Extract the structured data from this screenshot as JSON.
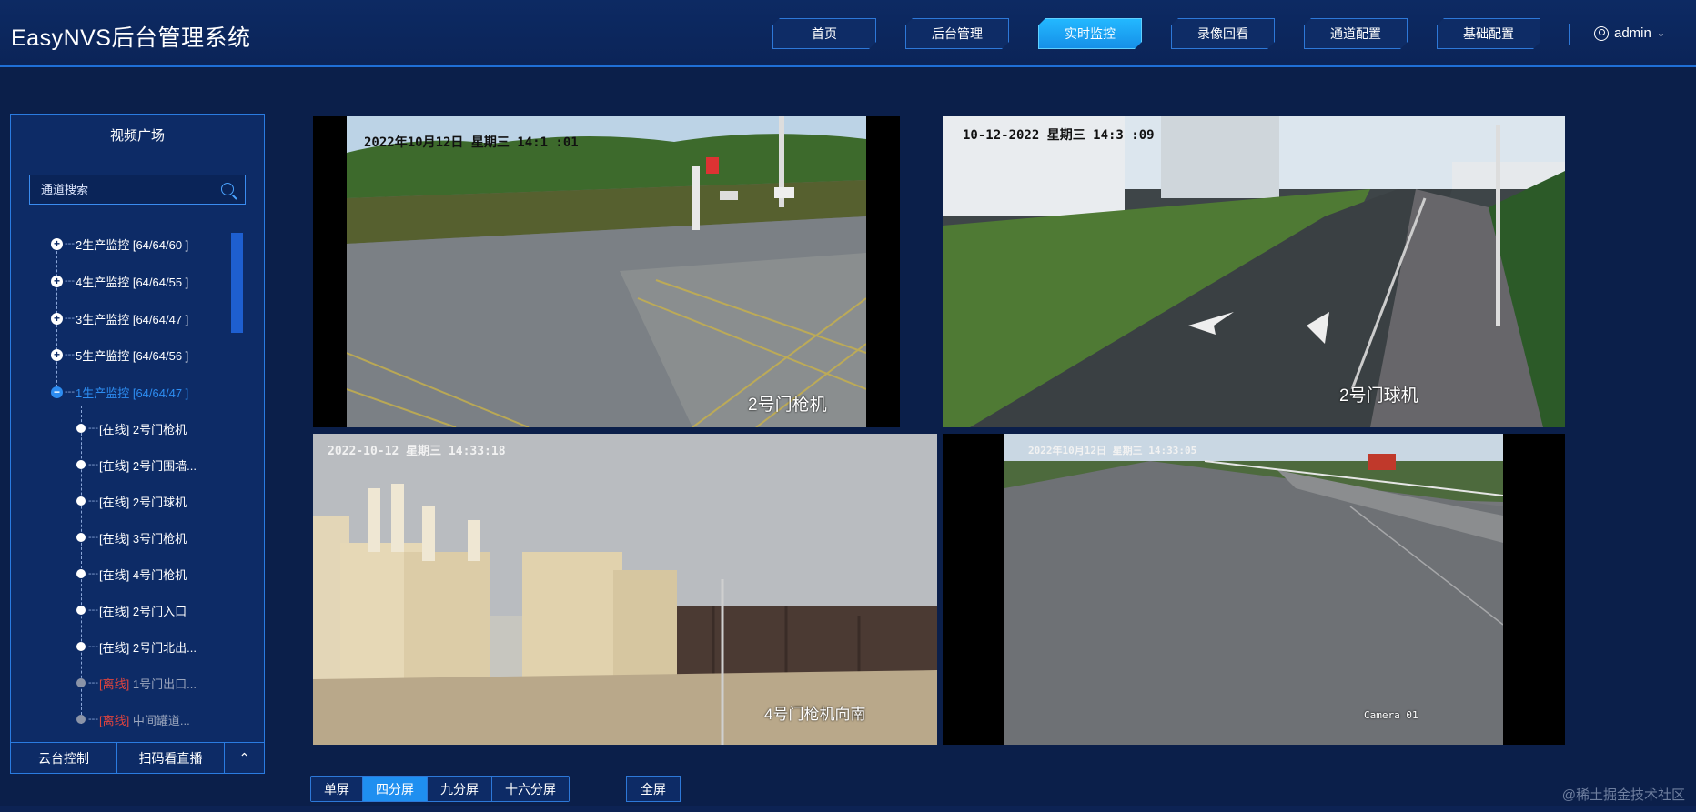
{
  "app": {
    "title": "EasyNVS后台管理系统"
  },
  "nav": {
    "items": [
      "首页",
      "后台管理",
      "实时监控",
      "录像回看",
      "通道配置",
      "基础配置"
    ],
    "active": "实时监控"
  },
  "user": {
    "name": "admin"
  },
  "sidebar": {
    "title": "视频广场",
    "search_placeholder": "通道搜索",
    "groups": [
      {
        "label": "2生产监控 [64/64/60 ]"
      },
      {
        "label": "4生产监控 [64/64/55 ]"
      },
      {
        "label": "3生产监控 [64/64/47 ]"
      },
      {
        "label": "5生产监控 [64/64/56 ]"
      },
      {
        "label": "1生产监控 [64/64/47 ]"
      }
    ],
    "channels": [
      {
        "status": "[在线]",
        "name": "2号门枪机"
      },
      {
        "status": "[在线]",
        "name": "2号门围墙..."
      },
      {
        "status": "[在线]",
        "name": "2号门球机"
      },
      {
        "status": "[在线]",
        "name": "3号门枪机"
      },
      {
        "status": "[在线]",
        "name": "4号门枪机"
      },
      {
        "status": "[在线]",
        "name": "2号门入口"
      },
      {
        "status": "[在线]",
        "name": "2号门北出..."
      },
      {
        "status": "[离线]",
        "name": "1号门出口..."
      },
      {
        "status": "[离线]",
        "name": "中间罐道..."
      }
    ],
    "footer": {
      "ptz": "云台控制",
      "scan": "扫码看直播"
    }
  },
  "cameras": [
    {
      "timestamp": "2022年10月12日 星期三 14:1 :01",
      "label": "2号门枪机"
    },
    {
      "timestamp": "10-12-2022 星期三 14:3 :09",
      "label": "2号门球机"
    },
    {
      "timestamp": "2022-10-12 星期三 14:33:18",
      "label": "4号门枪机向南"
    },
    {
      "timestamp": "2022年10月12日 星期三 14:33:05",
      "label": "Camera 01"
    }
  ],
  "layout": {
    "buttons": [
      "单屏",
      "四分屏",
      "九分屏",
      "十六分屏"
    ],
    "active": "四分屏",
    "fullscreen": "全屏"
  },
  "watermark": "@稀土掘金技术社区"
}
